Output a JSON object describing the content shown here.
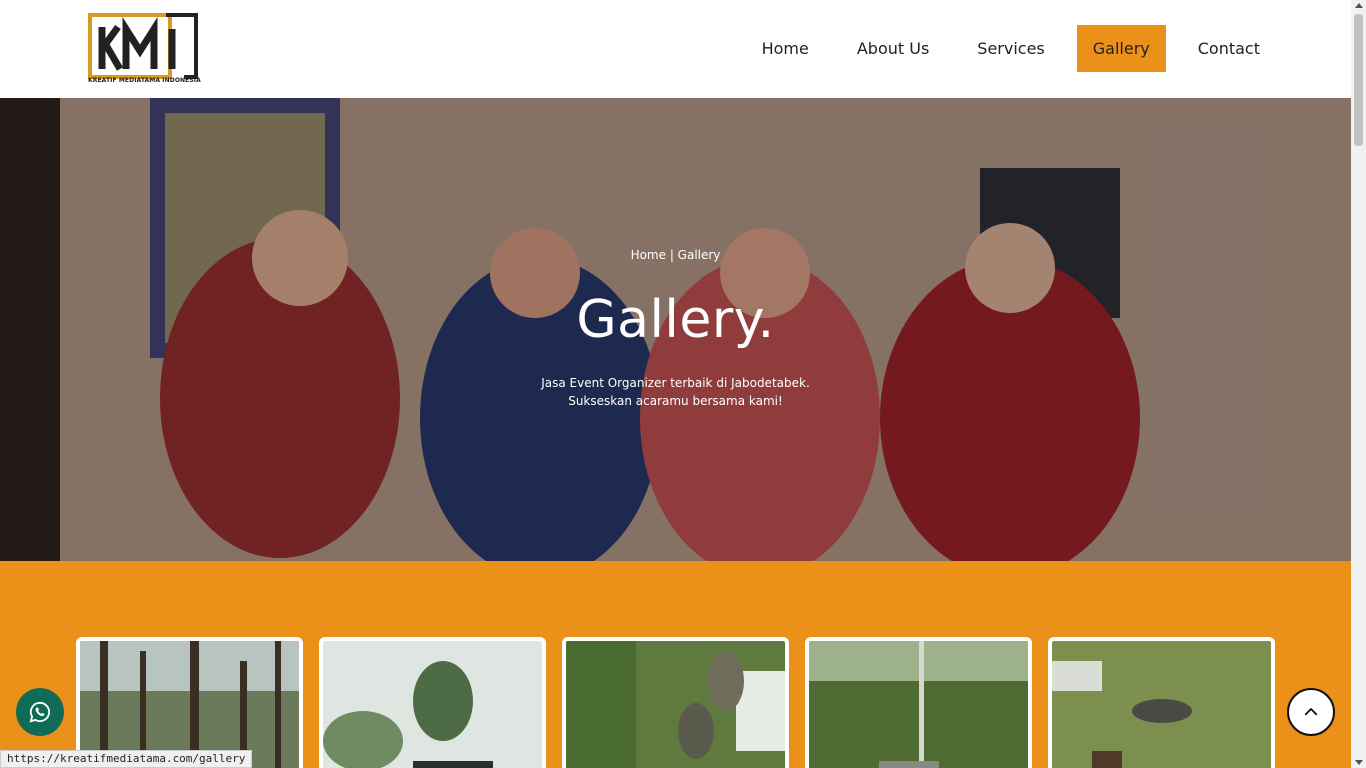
{
  "logo": {
    "letters": "KMI",
    "tagline": "KREATIF MEDIATAMA INDONESIA"
  },
  "nav": {
    "items": [
      {
        "label": "Home",
        "active": false
      },
      {
        "label": "About Us",
        "active": false
      },
      {
        "label": "Services",
        "active": false
      },
      {
        "label": "Gallery",
        "active": true
      },
      {
        "label": "Contact",
        "active": false
      }
    ]
  },
  "hero": {
    "breadcrumb": "Home | Gallery",
    "title": "Gallery.",
    "desc_line1": "Jasa Event Organizer terbaik di Jabodetabek.",
    "desc_line2": "Sukseskan acaramu bersama kami!"
  },
  "gallery": {
    "items": [
      "forest-trees-photo",
      "misty-forest-vehicle-photo",
      "paintball-players-photo",
      "jungle-offroad-photo",
      "paintball-field-photo"
    ]
  },
  "floating": {
    "whatsapp_icon": "whatsapp-icon",
    "back_to_top_icon": "chevron-up-icon"
  },
  "status_bar": {
    "url": "https://kreatifmediatama.com/gallery"
  },
  "colors": {
    "accent": "#eb9119",
    "whatsapp": "#0f6b55",
    "text": "#222222"
  }
}
